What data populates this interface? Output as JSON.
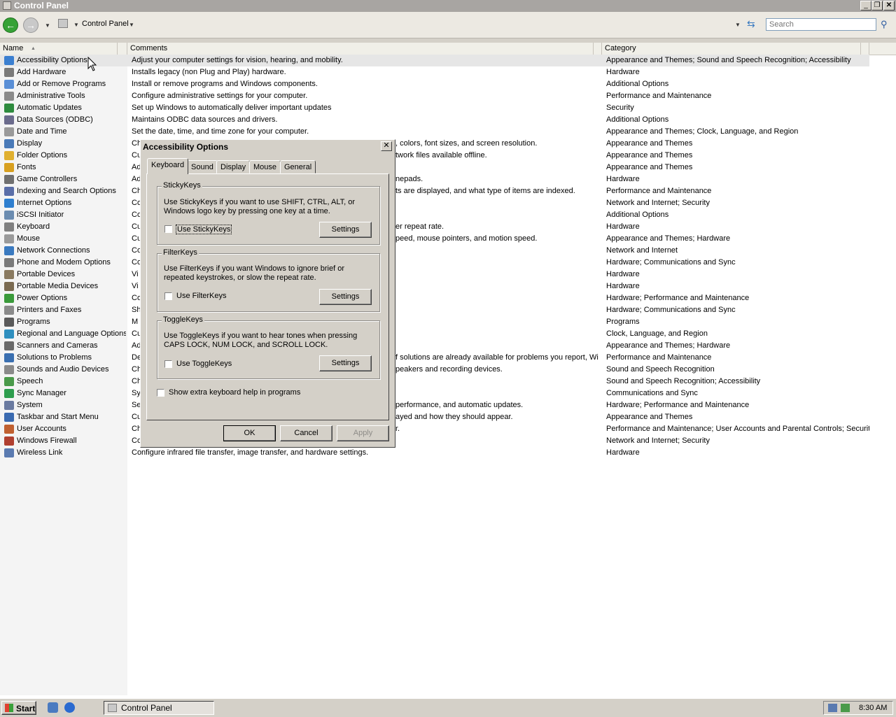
{
  "window": {
    "title": "Control Panel"
  },
  "toolbar": {
    "address_label": "Control Panel",
    "search_placeholder": "Search"
  },
  "columns": {
    "name": "Name",
    "comments": "Comments",
    "category": "Category"
  },
  "items": [
    {
      "name": "Accessibility Options",
      "comment": "Adjust your computer settings for vision, hearing, and mobility.",
      "category": "Appearance and Themes; Sound and Speech Recognition; Accessibility",
      "color": "#3b7fd0"
    },
    {
      "name": "Add Hardware",
      "comment": "Installs legacy (non Plug and Play) hardware.",
      "category": "Hardware",
      "color": "#7a7a7a"
    },
    {
      "name": "Add or Remove Programs",
      "comment": "Install or remove programs and Windows components.",
      "category": "Additional Options",
      "color": "#5a8fd6"
    },
    {
      "name": "Administrative Tools",
      "comment": "Configure administrative settings for your computer.",
      "category": "Performance and Maintenance",
      "color": "#8a8a8a"
    },
    {
      "name": "Automatic Updates",
      "comment": "Set up Windows to automatically deliver important updates",
      "category": "Security",
      "color": "#2e8b3e"
    },
    {
      "name": "Data Sources (ODBC)",
      "comment": "Maintains ODBC data sources and drivers.",
      "category": "Additional Options",
      "color": "#6b6b8c"
    },
    {
      "name": "Date and Time",
      "comment": "Set the date, time, and time zone for your computer.",
      "category": "Appearance and Themes; Clock, Language, and Region",
      "color": "#9a9a9a"
    },
    {
      "name": "Display",
      "comment": "Ch",
      "comment_right": ", colors, font sizes, and screen resolution.",
      "category": "Appearance and Themes",
      "color": "#4a7ab8"
    },
    {
      "name": "Folder Options",
      "comment": "Cu",
      "comment_right": "twork files available offline.",
      "category": "Appearance and Themes",
      "color": "#e0b030"
    },
    {
      "name": "Fonts",
      "comment": "Ad",
      "comment_right": "",
      "category": "Appearance and Themes",
      "color": "#d8a020"
    },
    {
      "name": "Game Controllers",
      "comment": "Ad",
      "comment_right": "nepads.",
      "category": "Hardware",
      "color": "#707070"
    },
    {
      "name": "Indexing and Search Options",
      "comment": "Ch",
      "comment_right": "ts are displayed, and what type of items are indexed.",
      "category": "Performance and Maintenance",
      "color": "#5a6ea8"
    },
    {
      "name": "Internet Options",
      "comment": "Co",
      "comment_right": "",
      "category": "Network and Internet; Security",
      "color": "#2f7fcf"
    },
    {
      "name": "iSCSI Initiator",
      "comment": "Co",
      "comment_right": "",
      "category": "Additional Options",
      "color": "#6b8cb0"
    },
    {
      "name": "Keyboard",
      "comment": "Cu",
      "comment_right": "er repeat rate.",
      "category": "Hardware",
      "color": "#808080"
    },
    {
      "name": "Mouse",
      "comment": "Cu",
      "comment_right": "peed, mouse pointers, and motion speed.",
      "category": "Appearance and Themes; Hardware",
      "color": "#9a9a9a"
    },
    {
      "name": "Network Connections",
      "comment": "Co",
      "comment_right": "",
      "category": "Network and Internet",
      "color": "#3a7ac0"
    },
    {
      "name": "Phone and Modem Options",
      "comment": "Co",
      "comment_right": "",
      "category": "Hardware; Communications and Sync",
      "color": "#7a7a7a"
    },
    {
      "name": "Portable Devices",
      "comment": "Vi",
      "comment_right": "",
      "category": "Hardware",
      "color": "#8a7a60"
    },
    {
      "name": "Portable Media Devices",
      "comment": "Vi",
      "comment_right": "",
      "category": "Hardware",
      "color": "#7a6a50"
    },
    {
      "name": "Power Options",
      "comment": "Co",
      "comment_right": "",
      "category": "Hardware; Performance and Maintenance",
      "color": "#3a9a3a"
    },
    {
      "name": "Printers and Faxes",
      "comment": "Sh",
      "comment_right": "",
      "category": "Hardware; Communications and Sync",
      "color": "#8a8a8a"
    },
    {
      "name": "Programs",
      "comment": "M",
      "comment_right": "",
      "category": "Programs",
      "color": "#5a5a5a"
    },
    {
      "name": "Regional and Language Options",
      "comment": "Cu",
      "comment_right": "",
      "category": "Clock, Language, and Region",
      "color": "#2f8fbf"
    },
    {
      "name": "Scanners and Cameras",
      "comment": "Ad",
      "comment_right": "",
      "category": "Appearance and Themes; Hardware",
      "color": "#6a6a6a"
    },
    {
      "name": "Solutions to Problems",
      "comment": "De",
      "comment_right": "f solutions are already available for problems you report, Wi...",
      "category": "Performance and Maintenance",
      "color": "#3a6fb0"
    },
    {
      "name": "Sounds and Audio Devices",
      "comment": "Ch",
      "comment_right": "peakers and recording devices.",
      "category": "Sound and Speech Recognition",
      "color": "#8a8a8a"
    },
    {
      "name": "Speech",
      "comment": "Ch",
      "comment_right": "",
      "category": "Sound and Speech Recognition; Accessibility",
      "color": "#4a9a4a"
    },
    {
      "name": "Sync Manager",
      "comment": "Sy",
      "comment_right": "",
      "category": "Communications and Sync",
      "color": "#2e9e4e"
    },
    {
      "name": "System",
      "comment": "Se",
      "comment_right": "performance, and automatic updates.",
      "category": "Hardware; Performance and Maintenance",
      "color": "#6a7aa0"
    },
    {
      "name": "Taskbar and Start Menu",
      "comment": "Cu",
      "comment_right": "ayed and how they should appear.",
      "category": "Appearance and Themes",
      "color": "#3a6ab0"
    },
    {
      "name": "User Accounts",
      "comment": "Ch",
      "comment_right": "r.",
      "category": "Performance and Maintenance; User Accounts and Parental Controls; Security",
      "color": "#c06030"
    },
    {
      "name": "Windows Firewall",
      "comment": "Co",
      "comment_right": "",
      "category": "Network and Internet; Security",
      "color": "#b04030"
    },
    {
      "name": "Wireless Link",
      "comment": "Configure infrared file transfer, image transfer, and hardware settings.",
      "category": "Hardware",
      "color": "#5a7ab0"
    }
  ],
  "dialog": {
    "title": "Accessibility Options",
    "close": "✕",
    "tabs": [
      "Keyboard",
      "Sound",
      "Display",
      "Mouse",
      "General"
    ],
    "stickykeys": {
      "label": "StickyKeys",
      "desc": "Use StickyKeys if you want to use SHIFT, CTRL, ALT, or Windows logo key by pressing one key at a time.",
      "check": "Use StickyKeys",
      "settings": "Settings"
    },
    "filterkeys": {
      "label": "FilterKeys",
      "desc": "Use FilterKeys if you want Windows to ignore brief or repeated keystrokes, or slow the repeat rate.",
      "check": "Use FilterKeys",
      "settings": "Settings"
    },
    "togglekeys": {
      "label": "ToggleKeys",
      "desc": "Use ToggleKeys if you want to hear tones when pressing CAPS LOCK, NUM LOCK, and SCROLL LOCK.",
      "check": "Use ToggleKeys",
      "settings": "Settings"
    },
    "extra_help": "Show extra keyboard help in programs",
    "ok": "OK",
    "cancel": "Cancel",
    "apply": "Apply"
  },
  "taskbar": {
    "start": "Start",
    "task": "Control Panel",
    "clock": "8:30 AM"
  }
}
